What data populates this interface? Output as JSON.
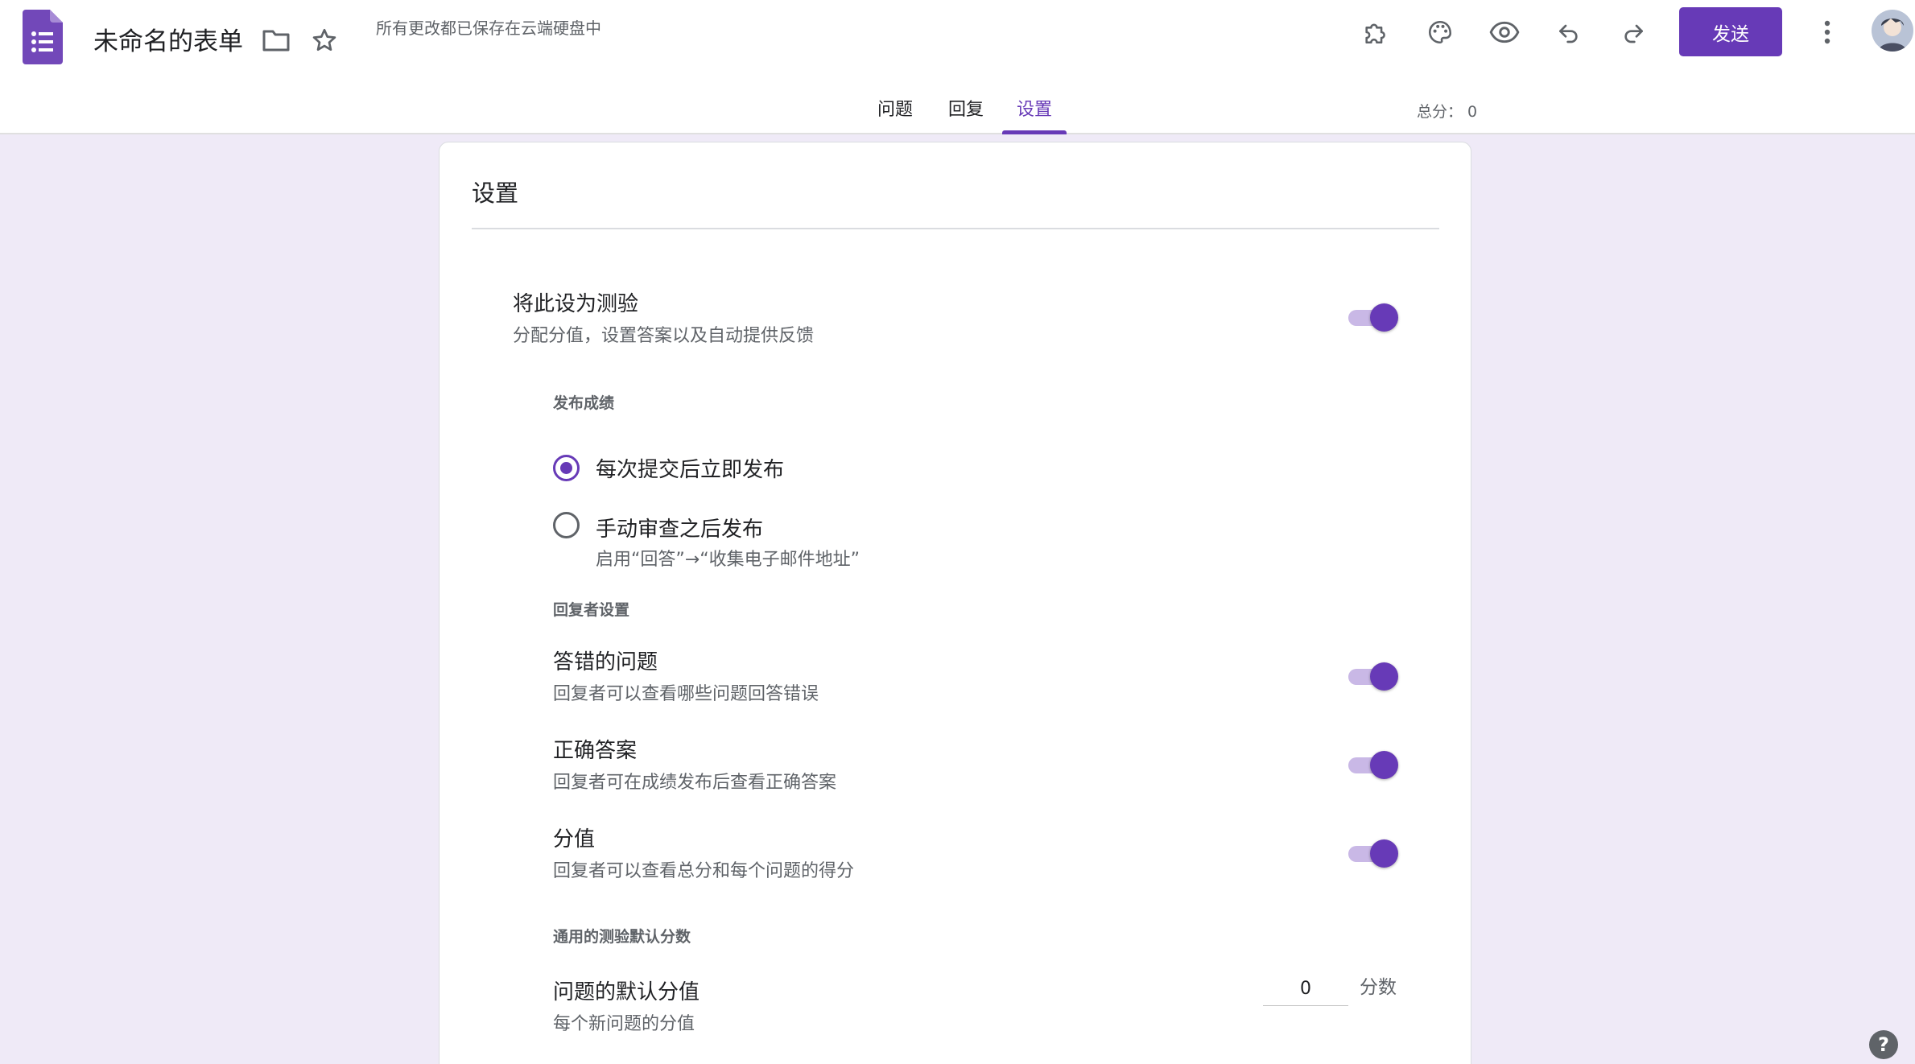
{
  "header": {
    "doc_title": "未命名的表单",
    "save_status": "所有更改都已保存在云端硬盘中",
    "send_label": "发送",
    "icons": [
      "forms-logo-icon",
      "folder-icon",
      "star-icon",
      "addon-puzzle-icon",
      "palette-icon",
      "preview-eye-icon",
      "undo-icon",
      "redo-icon",
      "more-vert-icon"
    ]
  },
  "tabs": {
    "items": [
      {
        "label": "问题"
      },
      {
        "label": "回复"
      },
      {
        "label": "设置"
      }
    ],
    "active_index": 2,
    "total_score": "总分： 0"
  },
  "settings": {
    "title": "设置",
    "quiz": {
      "title": "将此设为测验",
      "desc": "分配分值，设置答案以及自动提供反馈",
      "enabled": true
    },
    "release_grade": {
      "label": "发布成绩",
      "options": [
        {
          "title": "每次提交后立即发布",
          "desc": "",
          "selected": true
        },
        {
          "title": "手动审查之后发布",
          "desc": "启用“回答”→“收集电子邮件地址”",
          "selected": false
        }
      ]
    },
    "respondent": {
      "label": "回复者设置",
      "items": [
        {
          "title": "答错的问题",
          "desc": "回复者可以查看哪些问题回答错误",
          "enabled": true
        },
        {
          "title": "正确答案",
          "desc": "回复者可在成绩发布后查看正确答案",
          "enabled": true
        },
        {
          "title": "分值",
          "desc": "回复者可以查看总分和每个问题的得分",
          "enabled": true
        }
      ]
    },
    "defaults": {
      "label": "通用的测验默认分数",
      "title": "问题的默认分值",
      "desc": "每个新问题的分值",
      "value": "0",
      "unit": "分数"
    }
  },
  "help": {
    "label": "?"
  },
  "colors": {
    "accent": "#673ab7",
    "background": "#efeaf7",
    "toggle_track": "#c9b8e6"
  }
}
